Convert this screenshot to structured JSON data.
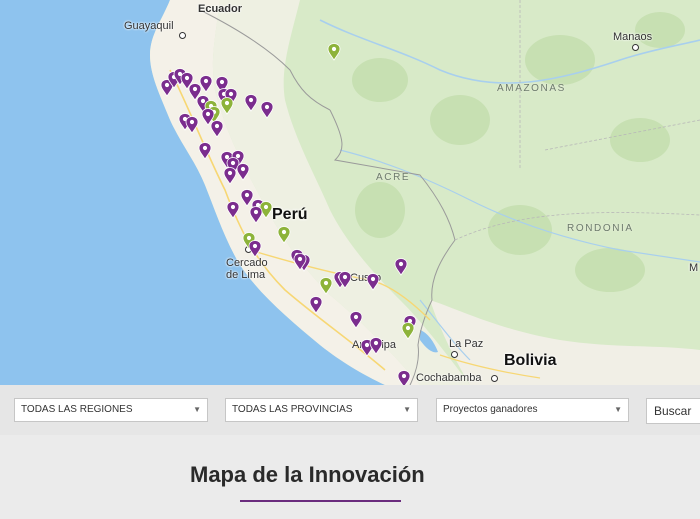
{
  "map": {
    "labels": {
      "ecuador": "Ecuador",
      "guayaquil": "Guayaquil",
      "manaos": "Manaos",
      "amazonas": "AMAZONAS",
      "acre": "ACRE",
      "rondonia": "RONDONIA",
      "peru": "Perú",
      "cercado_line1": "Cercado",
      "cercado_line2": "de Lima",
      "cusco": "Cusco",
      "arequipa": "Arequipa",
      "la_paz": "La Paz",
      "bolivia": "Bolivia",
      "cochabamba": "Cochabamba",
      "edge_m": "M"
    },
    "colors": {
      "pin_purple": "#7b2d8e",
      "pin_green": "#8db33a",
      "ocean": "#8ec3ee",
      "land": "#f5f3ec",
      "forest": "#d5e8c5"
    }
  },
  "filters": {
    "region": "TODAS LAS REGIONES",
    "province": "TODAS LAS PROVINCIAS",
    "projects": "Proyectos ganadores",
    "search_label": "Buscar"
  },
  "section": {
    "title": "Mapa de la Innovación"
  }
}
